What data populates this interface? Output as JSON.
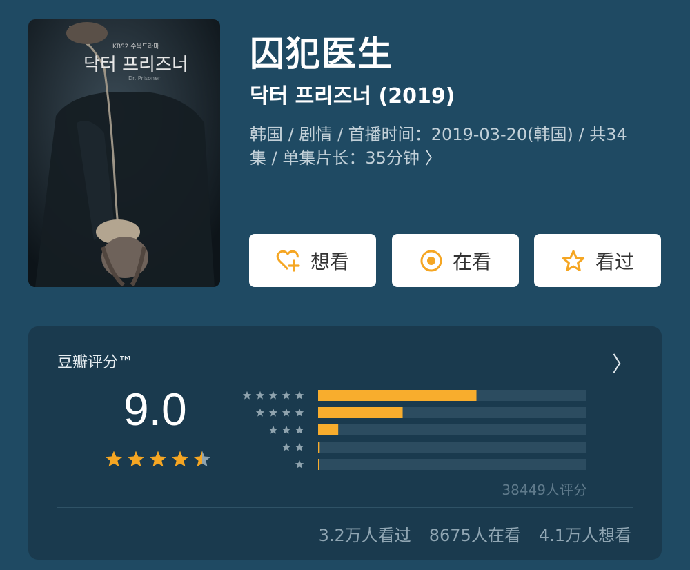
{
  "title": "囚犯医生",
  "original_title": "닥터 프리즈너 (2019)",
  "meta": {
    "line1": "韩国 / 剧情 / 首播时间：2019-03-20(韩国) / 共34",
    "line2": "集 / 单集片长：35分钟"
  },
  "poster": {
    "logo_text": "닥터 프리즈너"
  },
  "buttons": {
    "want": "想看",
    "watching": "在看",
    "watched": "看过"
  },
  "rating": {
    "label": "豆瓣评分™",
    "score": "9.0",
    "stars": 4.5,
    "distribution_fraction": [
      0.59,
      0.315,
      0.075,
      0.006,
      0.004
    ],
    "raters": "38449人评分"
  },
  "stats": {
    "watched": "3.2万人看过",
    "watching": "8675人在看",
    "want": "4.1万人想看"
  },
  "colors": {
    "background": "#1f4a63",
    "card": "#1a3a4e",
    "accent_star": "#f5a623",
    "bar_fill": "#f8ad2d",
    "bar_track": "#2c4c60"
  },
  "icons": [
    "heart-plus-icon",
    "target-icon",
    "star-icon",
    "chevron-right-icon"
  ]
}
